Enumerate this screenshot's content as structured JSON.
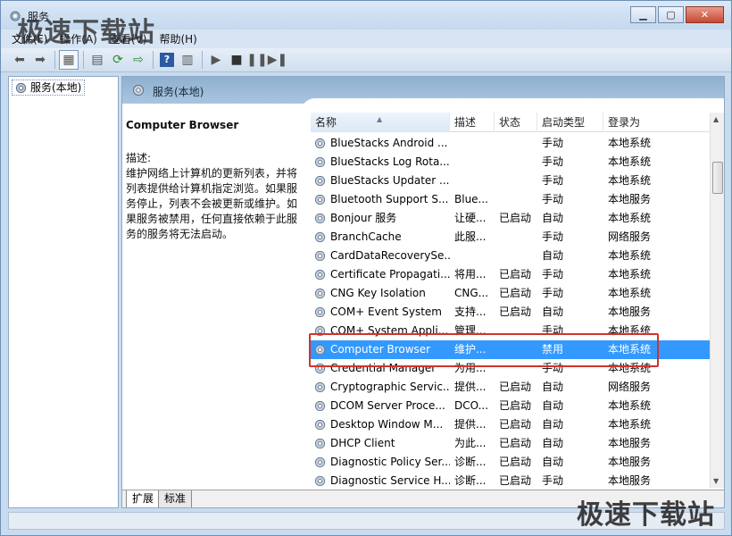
{
  "window": {
    "title": "服务",
    "watermark": "极速下载站"
  },
  "menu": [
    "文件(F)",
    "操作(A)",
    "查看(V)",
    "帮助(H)"
  ],
  "tree": {
    "root_label": "服务(本地)"
  },
  "pane": {
    "header": "服务(本地)"
  },
  "detail": {
    "title": "Computer Browser",
    "desc_label": "描述:",
    "desc_text": "维护网络上计算机的更新列表，并将列表提供给计算机指定浏览。如果服务停止，列表不会被更新或维护。如果服务被禁用，任何直接依赖于此服务的服务将无法启动。"
  },
  "columns": [
    "名称",
    "描述",
    "状态",
    "启动类型",
    "登录为"
  ],
  "services": [
    {
      "name": "BlueStacks Android ...",
      "desc": "",
      "status": "",
      "start": "手动",
      "logon": "本地系统"
    },
    {
      "name": "BlueStacks Log Rota...",
      "desc": "",
      "status": "",
      "start": "手动",
      "logon": "本地系统"
    },
    {
      "name": "BlueStacks Updater ...",
      "desc": "",
      "status": "",
      "start": "手动",
      "logon": "本地系统"
    },
    {
      "name": "Bluetooth Support S...",
      "desc": "Blue...",
      "status": "",
      "start": "手动",
      "logon": "本地服务"
    },
    {
      "name": "Bonjour 服务",
      "desc": "让硬...",
      "status": "已启动",
      "start": "自动",
      "logon": "本地系统"
    },
    {
      "name": "BranchCache",
      "desc": "此服...",
      "status": "",
      "start": "手动",
      "logon": "网络服务"
    },
    {
      "name": "CardDataRecoverySe...",
      "desc": "",
      "status": "",
      "start": "自动",
      "logon": "本地系统"
    },
    {
      "name": "Certificate Propagati...",
      "desc": "将用...",
      "status": "已启动",
      "start": "手动",
      "logon": "本地系统"
    },
    {
      "name": "CNG Key Isolation",
      "desc": "CNG...",
      "status": "已启动",
      "start": "手动",
      "logon": "本地系统"
    },
    {
      "name": "COM+ Event System",
      "desc": "支持...",
      "status": "已启动",
      "start": "自动",
      "logon": "本地服务"
    },
    {
      "name": "COM+ System Appli...",
      "desc": "管理...",
      "status": "",
      "start": "手动",
      "logon": "本地系统"
    },
    {
      "name": "Computer Browser",
      "desc": "维护...",
      "status": "",
      "start": "禁用",
      "logon": "本地系统",
      "selected": true
    },
    {
      "name": "Credential Manager",
      "desc": "为用...",
      "status": "",
      "start": "手动",
      "logon": "本地系统"
    },
    {
      "name": "Cryptographic Servic...",
      "desc": "提供...",
      "status": "已启动",
      "start": "自动",
      "logon": "网络服务"
    },
    {
      "name": "DCOM Server Proce...",
      "desc": "DCO...",
      "status": "已启动",
      "start": "自动",
      "logon": "本地系统"
    },
    {
      "name": "Desktop Window M...",
      "desc": "提供...",
      "status": "已启动",
      "start": "自动",
      "logon": "本地系统"
    },
    {
      "name": "DHCP Client",
      "desc": "为此...",
      "status": "已启动",
      "start": "自动",
      "logon": "本地服务"
    },
    {
      "name": "Diagnostic Policy Ser...",
      "desc": "诊断...",
      "status": "已启动",
      "start": "自动",
      "logon": "本地服务"
    },
    {
      "name": "Diagnostic Service H...",
      "desc": "诊断...",
      "status": "已启动",
      "start": "手动",
      "logon": "本地服务"
    }
  ],
  "tabs": [
    "扩展",
    "标准"
  ]
}
